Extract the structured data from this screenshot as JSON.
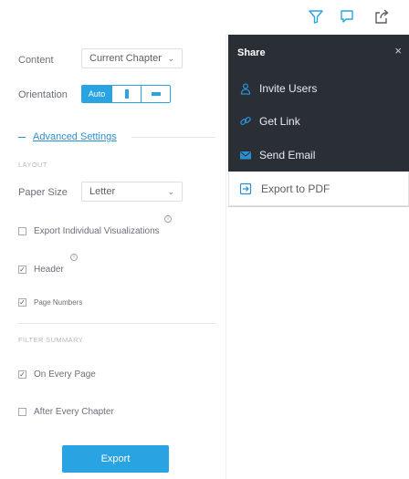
{
  "toolbar": {
    "icons": [
      "filter-icon",
      "comment-icon",
      "share-icon"
    ],
    "accent": "#2aa3e2"
  },
  "settings": {
    "content_label": "Content",
    "content_value": "Current Chapter",
    "orientation_label": "Orientation",
    "orientation_options": [
      "Auto",
      "portrait",
      "landscape"
    ],
    "orientation_selected": "Auto",
    "advanced_label": "Advanced Settings",
    "layout_section": "LAYOUT",
    "paper_size_label": "Paper Size",
    "paper_size_value": "Letter",
    "export_individual_label": "Export Individual Visualizations",
    "header_label": "Header",
    "page_numbers_label": "Page Numbers",
    "filter_section": "FILTER SUMMARY",
    "on_every_page_label": "On Every Page",
    "after_every_chapter_label": "After Every Chapter",
    "export_button": "Export",
    "checks": {
      "export_individual": false,
      "header": true,
      "page_numbers": true,
      "on_every_page": true,
      "after_every_chapter": false
    }
  },
  "share": {
    "title": "Share",
    "close": "×",
    "items": [
      "Invite Users",
      "Get Link",
      "Send Email"
    ],
    "export_pdf": "Export to PDF",
    "dark_bg": "#2a2f36",
    "icon_color": "#2a8fd0"
  }
}
